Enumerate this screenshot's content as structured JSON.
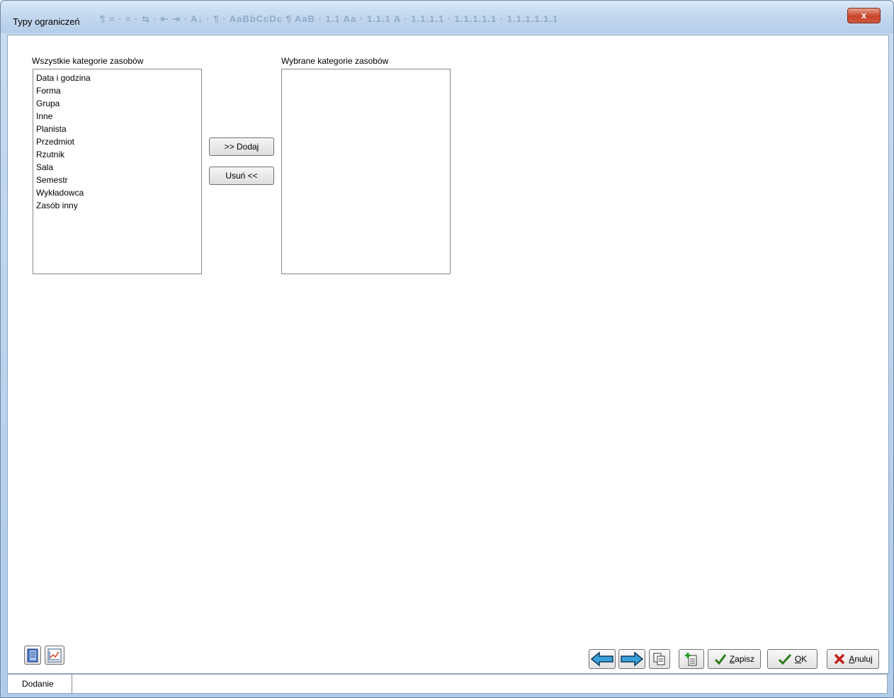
{
  "window": {
    "title": "Typy ograniczeń",
    "close_label": "x"
  },
  "left_list": {
    "label": "Wszystkie kategorie zasobów",
    "items": [
      "Data i godzina",
      "Forma",
      "Grupa",
      "Inne",
      "Planista",
      "Przedmiot",
      "Rzutnik",
      "Sala",
      "Semestr",
      "Wykładowca",
      "Zasób inny"
    ]
  },
  "right_list": {
    "label": "Wybrane kategorie zasobów",
    "items": []
  },
  "buttons": {
    "add": ">> Dodaj",
    "remove": "Usuń <<"
  },
  "footer": {
    "save_accel": "Z",
    "save_rest": "apisz",
    "ok_accel": "O",
    "ok_rest": "K",
    "cancel_accel": "A",
    "cancel_rest": "nuluj"
  },
  "status": {
    "mode": "Dodanie"
  },
  "colors": {
    "accent_blue": "#3aa0d8",
    "check_green": "#2a7a1a",
    "cancel_red": "#c0201a"
  }
}
